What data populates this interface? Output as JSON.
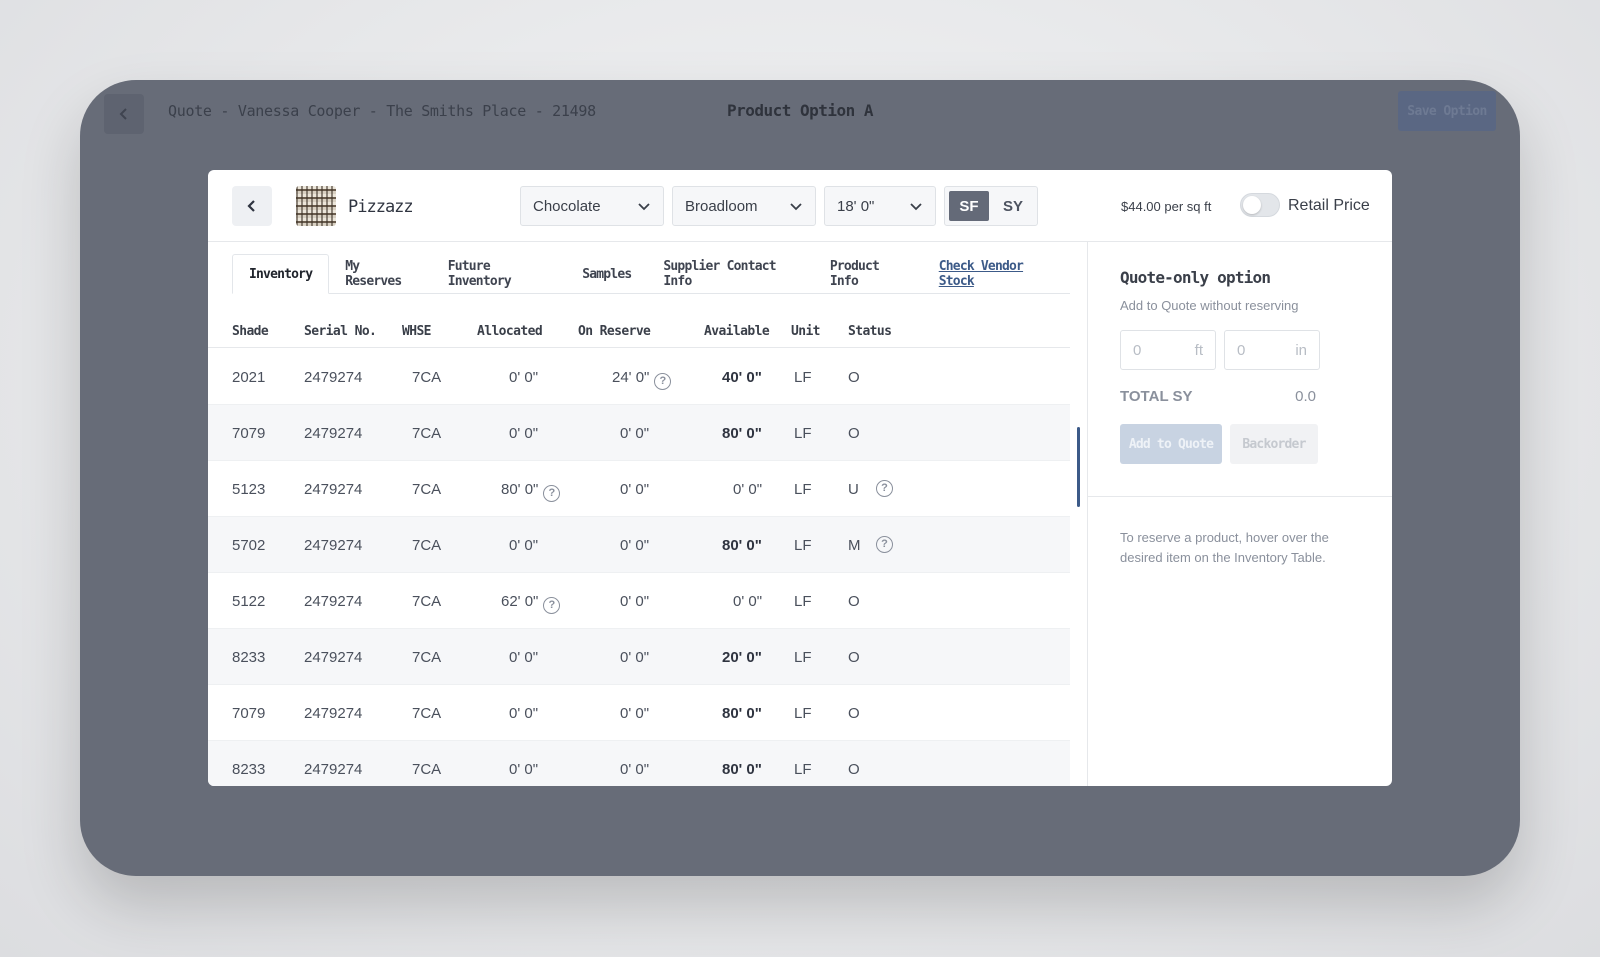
{
  "topbar": {
    "quote_title": "Quote - Vanessa Cooper - The Smiths Place - 21498",
    "option_title": "Product Option A",
    "save_label": "Save Option"
  },
  "product": {
    "name": "Pizzazz",
    "color_select": "Chocolate",
    "type_select": "Broadloom",
    "width_select": "18' 0\"",
    "unit_sf": "SF",
    "unit_sy": "SY",
    "active_unit": "SF",
    "price": "$44.00 per sq ft",
    "retail_label": "Retail Price",
    "retail_on": false
  },
  "tabs": [
    "Inventory",
    "My Reserves",
    "Future Inventory",
    "Samples",
    "Supplier Contact Info",
    "Product Info"
  ],
  "vendor_link": "Check Vendor Stock",
  "table": {
    "headers": [
      "Shade",
      "Serial No.",
      "WHSE",
      "Allocated",
      "On Reserve",
      "Available",
      "Unit",
      "Status"
    ],
    "rows": [
      {
        "shade": "2021",
        "serial": "2479274",
        "whse": "7CA",
        "allocated": "0' 0\"",
        "reserve": "24' 0\"",
        "available": "40' 0\"",
        "unit": "LF",
        "status": "O"
      },
      {
        "shade": "7079",
        "serial": "2479274",
        "whse": "7CA",
        "allocated": "0' 0\"",
        "reserve": "0' 0\"",
        "available": "80' 0\"",
        "unit": "LF",
        "status": "O"
      },
      {
        "shade": "5123",
        "serial": "2479274",
        "whse": "7CA",
        "allocated": "80' 0\"",
        "reserve": "0' 0\"",
        "available": "0' 0\"",
        "unit": "LF",
        "status": "U"
      },
      {
        "shade": "5702",
        "serial": "2479274",
        "whse": "7CA",
        "allocated": "0' 0\"",
        "reserve": "0' 0\"",
        "available": "80' 0\"",
        "unit": "LF",
        "status": "M"
      },
      {
        "shade": "5122",
        "serial": "2479274",
        "whse": "7CA",
        "allocated": "62' 0\"",
        "reserve": "0' 0\"",
        "available": "0' 0\"",
        "unit": "LF",
        "status": "O"
      },
      {
        "shade": "8233",
        "serial": "2479274",
        "whse": "7CA",
        "allocated": "0' 0\"",
        "reserve": "0' 0\"",
        "available": "20' 0\"",
        "unit": "LF",
        "status": "O"
      },
      {
        "shade": "7079",
        "serial": "2479274",
        "whse": "7CA",
        "allocated": "0' 0\"",
        "reserve": "0' 0\"",
        "available": "80' 0\"",
        "unit": "LF",
        "status": "O"
      },
      {
        "shade": "8233",
        "serial": "2479274",
        "whse": "7CA",
        "allocated": "0' 0\"",
        "reserve": "0' 0\"",
        "available": "80' 0\"",
        "unit": "LF",
        "status": "O"
      }
    ]
  },
  "quote_panel": {
    "title": "Quote-only option",
    "subtitle": "Add to Quote without reserving",
    "ft_placeholder": "0",
    "ft_unit": "ft",
    "in_placeholder": "0",
    "in_unit": "in",
    "total_label": "TOTAL SY",
    "total_value": "0.0",
    "add_label": "Add to Quote",
    "backorder_label": "Backorder",
    "hint": "To reserve a product, hover over the desired item on the Inventory Table."
  }
}
